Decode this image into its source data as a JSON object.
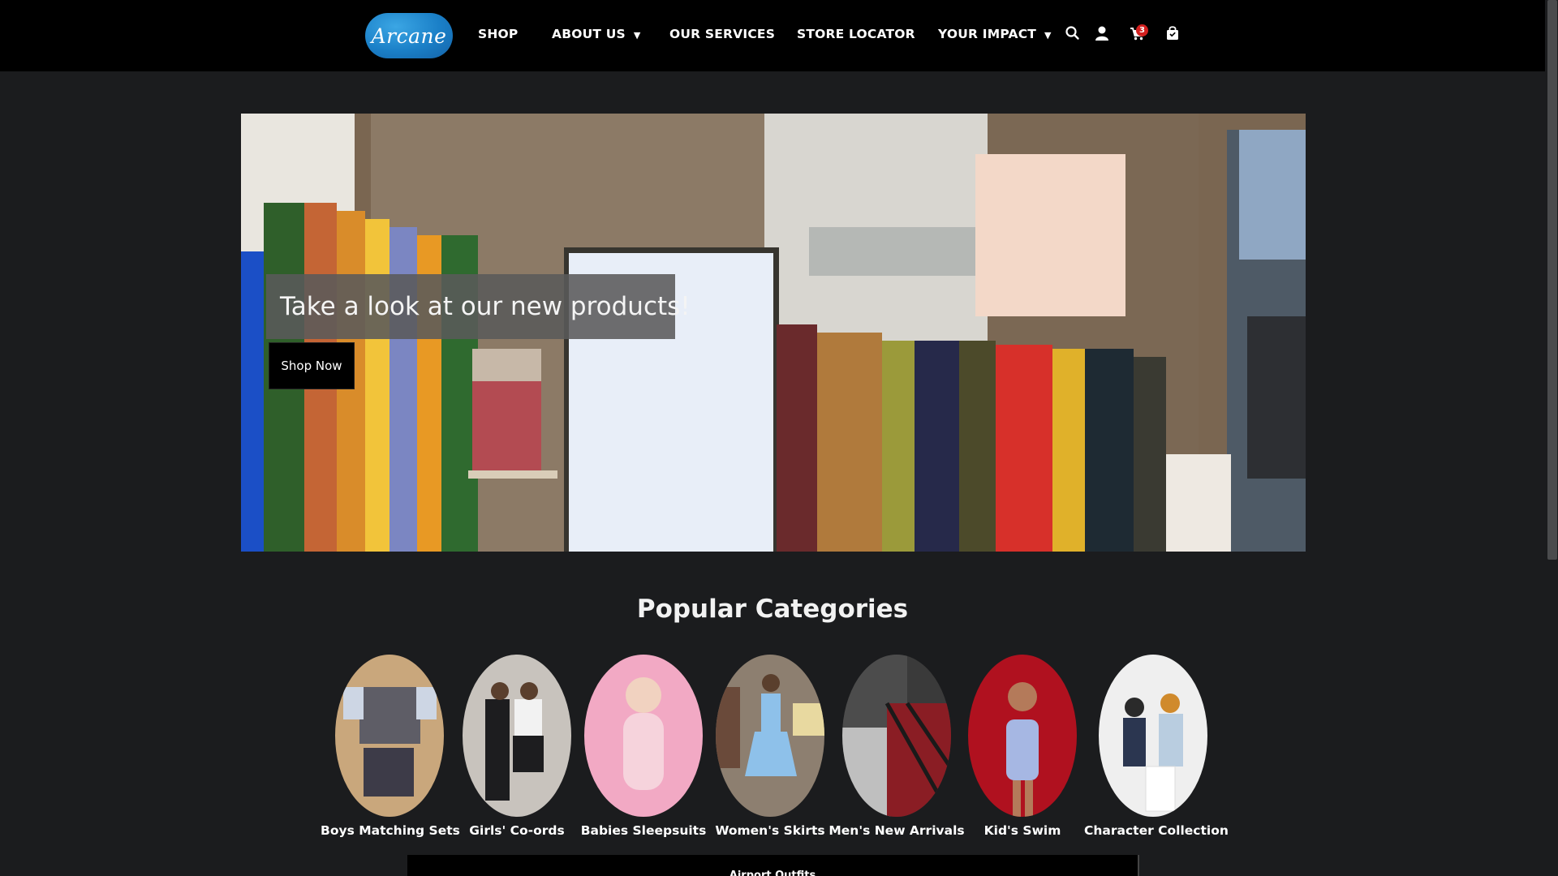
{
  "nav": {
    "logo": "Arcane",
    "items": [
      {
        "label": "SHOP",
        "dropdown": false
      },
      {
        "label": "ABOUT US",
        "dropdown": true
      },
      {
        "label": "OUR SERVICES",
        "dropdown": false
      },
      {
        "label": "STORE LOCATOR",
        "dropdown": false
      },
      {
        "label": "YOUR IMPACT",
        "dropdown": true
      }
    ],
    "caret": "▼",
    "icons": [
      "search-icon",
      "user-icon",
      "cart-icon",
      "bag-icon"
    ],
    "cart_count": "3"
  },
  "hero": {
    "caption": "Take a look at our new products!",
    "button": "Shop Now"
  },
  "categories": {
    "title": "Popular Categories",
    "items": [
      {
        "label": "Boys Matching Sets",
        "bg": "#c9a77c",
        "accent": "#5e5d66"
      },
      {
        "label": "Girls' Co-ords",
        "bg": "#c8c3bd",
        "accent": "#1d1d1f"
      },
      {
        "label": "Babies Sleepsuits",
        "bg": "#f2a9c4",
        "accent": "#f6d3dc"
      },
      {
        "label": "Women's Skirts",
        "bg": "#8d7f70",
        "accent": "#8ec1ea"
      },
      {
        "label": "Men's New Arrivals",
        "bg": "#3a3a3a",
        "accent": "#8a1d24"
      },
      {
        "label": "Kid's Swim",
        "bg": "#b0111f",
        "accent": "#a6b7e3"
      },
      {
        "label": "Character Collection",
        "bg": "#efefef",
        "accent": "#2b3650"
      }
    ]
  },
  "bottom": {
    "label": "Airport Outfits"
  },
  "colors": {
    "nav_bg": "#000000",
    "page_bg": "#1b1c1e",
    "logo_blue": "#1a7fc7",
    "badge_red": "#d3201f"
  }
}
